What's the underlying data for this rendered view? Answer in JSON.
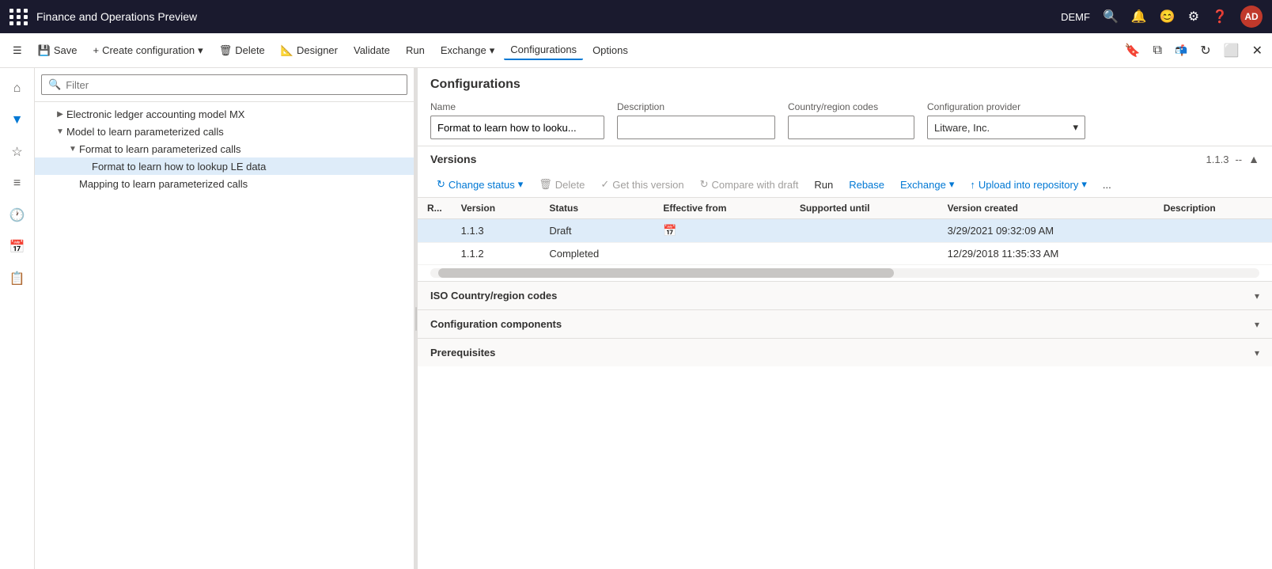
{
  "titlebar": {
    "app_name": "Finance and Operations Preview",
    "user_initials": "AD",
    "user_env": "DEMF"
  },
  "commandbar": {
    "save_label": "Save",
    "create_config_label": "Create configuration",
    "delete_label": "Delete",
    "designer_label": "Designer",
    "validate_label": "Validate",
    "run_label": "Run",
    "exchange_label": "Exchange",
    "configurations_label": "Configurations",
    "options_label": "Options"
  },
  "tree": {
    "filter_placeholder": "Filter",
    "items": [
      {
        "id": "electronic-ledger",
        "label": "Electronic ledger accounting model MX",
        "indent": 1,
        "toggle": "▶",
        "selected": false
      },
      {
        "id": "model-parameterized",
        "label": "Model to learn parameterized calls",
        "indent": 1,
        "toggle": "▼",
        "selected": false
      },
      {
        "id": "format-parameterized",
        "label": "Format to learn parameterized calls",
        "indent": 2,
        "toggle": "▼",
        "selected": false
      },
      {
        "id": "format-lookup",
        "label": "Format to learn how to lookup LE data",
        "indent": 3,
        "toggle": "",
        "selected": true
      },
      {
        "id": "mapping-parameterized",
        "label": "Mapping to learn parameterized calls",
        "indent": 2,
        "toggle": "",
        "selected": false
      }
    ]
  },
  "content": {
    "section_title": "Configurations",
    "form": {
      "name_label": "Name",
      "name_value": "Format to learn how to looku...",
      "description_label": "Description",
      "description_value": "",
      "country_label": "Country/region codes",
      "country_value": "",
      "provider_label": "Configuration provider",
      "provider_value": "Litware, Inc."
    },
    "versions": {
      "section_label": "Versions",
      "current_version": "1.1.3",
      "separator": "--",
      "toolbar": {
        "change_status_label": "Change status",
        "delete_label": "Delete",
        "get_this_version_label": "Get this version",
        "compare_with_draft_label": "Compare with draft",
        "run_label": "Run",
        "rebase_label": "Rebase",
        "exchange_label": "Exchange",
        "upload_into_repo_label": "Upload into repository",
        "more_label": "..."
      },
      "columns": {
        "r": "R...",
        "version": "Version",
        "status": "Status",
        "effective_from": "Effective from",
        "supported_until": "Supported until",
        "version_created": "Version created",
        "description": "Description"
      },
      "rows": [
        {
          "r": "",
          "version": "1.1.3",
          "status": "Draft",
          "effective_from": "",
          "has_cal": true,
          "supported_until": "",
          "version_created": "3/29/2021 09:32:09 AM",
          "description": "",
          "selected": true
        },
        {
          "r": "",
          "version": "1.1.2",
          "status": "Completed",
          "effective_from": "",
          "has_cal": false,
          "supported_until": "",
          "version_created": "12/29/2018 11:35:33 AM",
          "description": "",
          "selected": false
        }
      ]
    },
    "collapse_sections": [
      {
        "id": "iso",
        "label": "ISO Country/region codes"
      },
      {
        "id": "components",
        "label": "Configuration components"
      },
      {
        "id": "prerequisites",
        "label": "Prerequisites"
      }
    ]
  }
}
